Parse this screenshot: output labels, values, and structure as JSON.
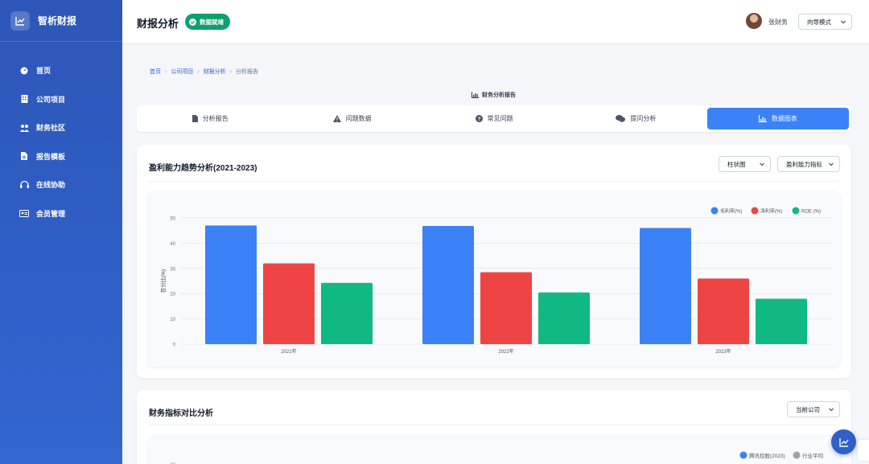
{
  "app": {
    "name": "智析财报"
  },
  "sidebar": {
    "items": [
      {
        "label": "首页",
        "icon": "dashboard-icon"
      },
      {
        "label": "公司项目",
        "icon": "building-icon"
      },
      {
        "label": "财务社区",
        "icon": "community-icon"
      },
      {
        "label": "报告模板",
        "icon": "file-icon"
      },
      {
        "label": "在线协助",
        "icon": "headset-icon"
      },
      {
        "label": "会员管理",
        "icon": "id-card-icon"
      }
    ]
  },
  "header": {
    "title": "财报分析",
    "status_badge": "数据就绪",
    "user_name": "张财务",
    "mode_select": "向导模式"
  },
  "breadcrumb": [
    "首页",
    "公司项目",
    "财报分析",
    "分析报告"
  ],
  "section_title": "财务分析报告",
  "tabs": [
    {
      "label": "分析报告",
      "icon": "file-icon"
    },
    {
      "label": "问题数据",
      "icon": "warning-icon"
    },
    {
      "label": "常见问题",
      "icon": "question-icon"
    },
    {
      "label": "提问分析",
      "icon": "chat-icon"
    },
    {
      "label": "数据图表",
      "icon": "chart-icon",
      "active": true
    }
  ],
  "card1": {
    "title": "盈利能力趋势分析(2021-2023)",
    "chart_type_select": "柱状图",
    "metric_select": "盈利能力指标"
  },
  "card2": {
    "title": "财务指标对比分析",
    "company_select": "当前公司",
    "legend": [
      "腾讯控股(2023)",
      "行业平均"
    ],
    "y_top_tick": "60"
  },
  "colors": {
    "sidebar": "#2f5fc7",
    "accent": "#3b82f6",
    "status_green": "#0e9f6e",
    "series_blue": "#3b82f6",
    "series_red": "#ef4444",
    "series_green": "#10b981",
    "industry_gray": "#9ca3af"
  },
  "chart_data": {
    "type": "bar",
    "categories": [
      "2021年",
      "2022年",
      "2023年"
    ],
    "series": [
      {
        "name": "毛利率(%)",
        "values": [
          47,
          46.8,
          46
        ]
      },
      {
        "name": "净利率(%)",
        "values": [
          32,
          28.5,
          26
        ]
      },
      {
        "name": "ROE (%)",
        "values": [
          24.3,
          20.5,
          18
        ]
      }
    ],
    "ylabel": "百分比(%)",
    "ylim": [
      0,
      50
    ],
    "yticks": [
      "0",
      "10",
      "20",
      "30",
      "40",
      "50"
    ],
    "grid": true,
    "legend_position": "top-right"
  }
}
